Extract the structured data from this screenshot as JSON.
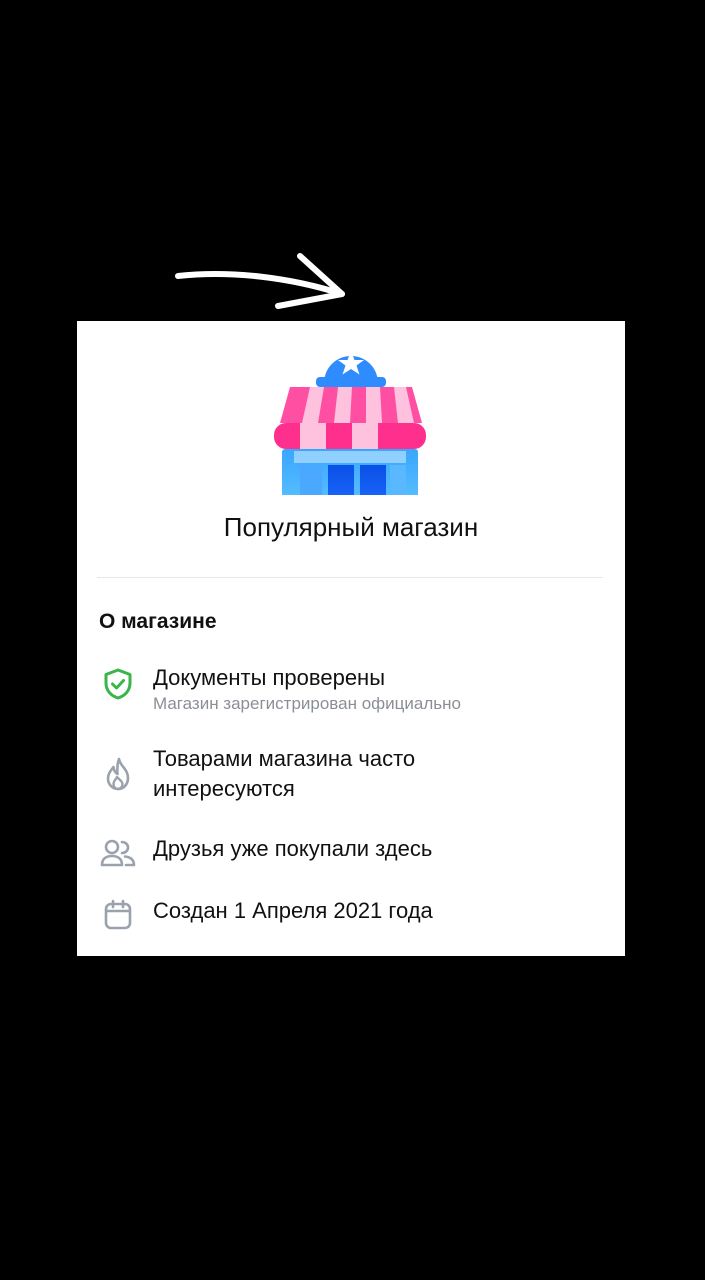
{
  "card": {
    "title": "Популярный магазин",
    "section_title": "О магазине",
    "items": [
      {
        "icon": "shield-check-icon",
        "title": "Документы проверены",
        "subtitle": "Магазин зарегистрирован официально"
      },
      {
        "icon": "fire-icon",
        "title": "Товарами магазина часто\nинтересуются"
      },
      {
        "icon": "users-icon",
        "title": "Друзья уже покупали здесь"
      },
      {
        "icon": "calendar-icon",
        "title": "Создан 1 Апреля 2021 года"
      }
    ]
  },
  "colors": {
    "background": "#000000",
    "card": "#ffffff",
    "verified_green": "#3bb54a",
    "icon_gray": "#99a2ad",
    "awning_pink": "#ff4fa3",
    "shop_blue": "#2f8cff"
  }
}
